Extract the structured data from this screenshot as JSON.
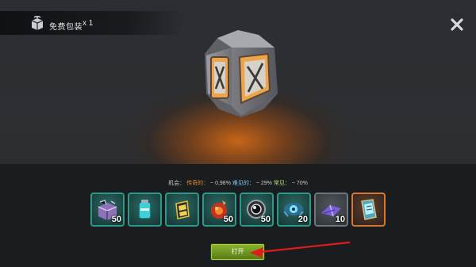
{
  "header": {
    "pack_title": "免费包装",
    "pack_count": "x 1",
    "pack_icon": "gift-box-icon",
    "close_icon": "close-icon"
  },
  "preview": {
    "item_icon": "crate-icon"
  },
  "odds": {
    "label": "机会：",
    "legendary_label": "传奇的：",
    "legendary_value": "~ 0,98%",
    "rare_label": "难见的：",
    "rare_value": "~ 29%",
    "common_label": "常见：",
    "common_value": "~ 70%",
    "colors": {
      "legendary": "#e8862c",
      "rare": "#7fc6e8",
      "common": "#b6e06a"
    }
  },
  "rewards": [
    {
      "icon": "box-icon",
      "qty": "50",
      "rarity": "teal"
    },
    {
      "icon": "battery-icon",
      "qty": "",
      "rarity": "teal"
    },
    {
      "icon": "power-cell-icon",
      "qty": "",
      "rarity": "teal"
    },
    {
      "icon": "fire-orb-icon",
      "qty": "50",
      "rarity": "teal"
    },
    {
      "icon": "lens-icon",
      "qty": "50",
      "rarity": "teal"
    },
    {
      "icon": "eye-drone-icon",
      "qty": "20",
      "rarity": "teal"
    },
    {
      "icon": "glider-icon",
      "qty": "10",
      "rarity": "grey"
    },
    {
      "icon": "device-card-icon",
      "qty": "",
      "rarity": "orange"
    }
  ],
  "actions": {
    "open_label": "打开",
    "accent": "#7ea626"
  },
  "annotation": {
    "arrow_color": "#e01b1b"
  }
}
